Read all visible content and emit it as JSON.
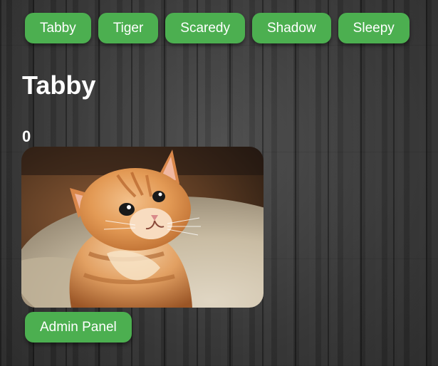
{
  "nav": {
    "buttons": [
      "Tabby",
      "Tiger",
      "Scaredy",
      "Shadow",
      "Sleepy"
    ]
  },
  "cat": {
    "name": "Tabby",
    "clicks": "0",
    "image_icon": "orange-tabby-kitten-photo"
  },
  "admin": {
    "label": "Admin Panel"
  },
  "colors": {
    "button": "#4caf50",
    "text": "#ffffff",
    "background": "#3b3b3b"
  }
}
